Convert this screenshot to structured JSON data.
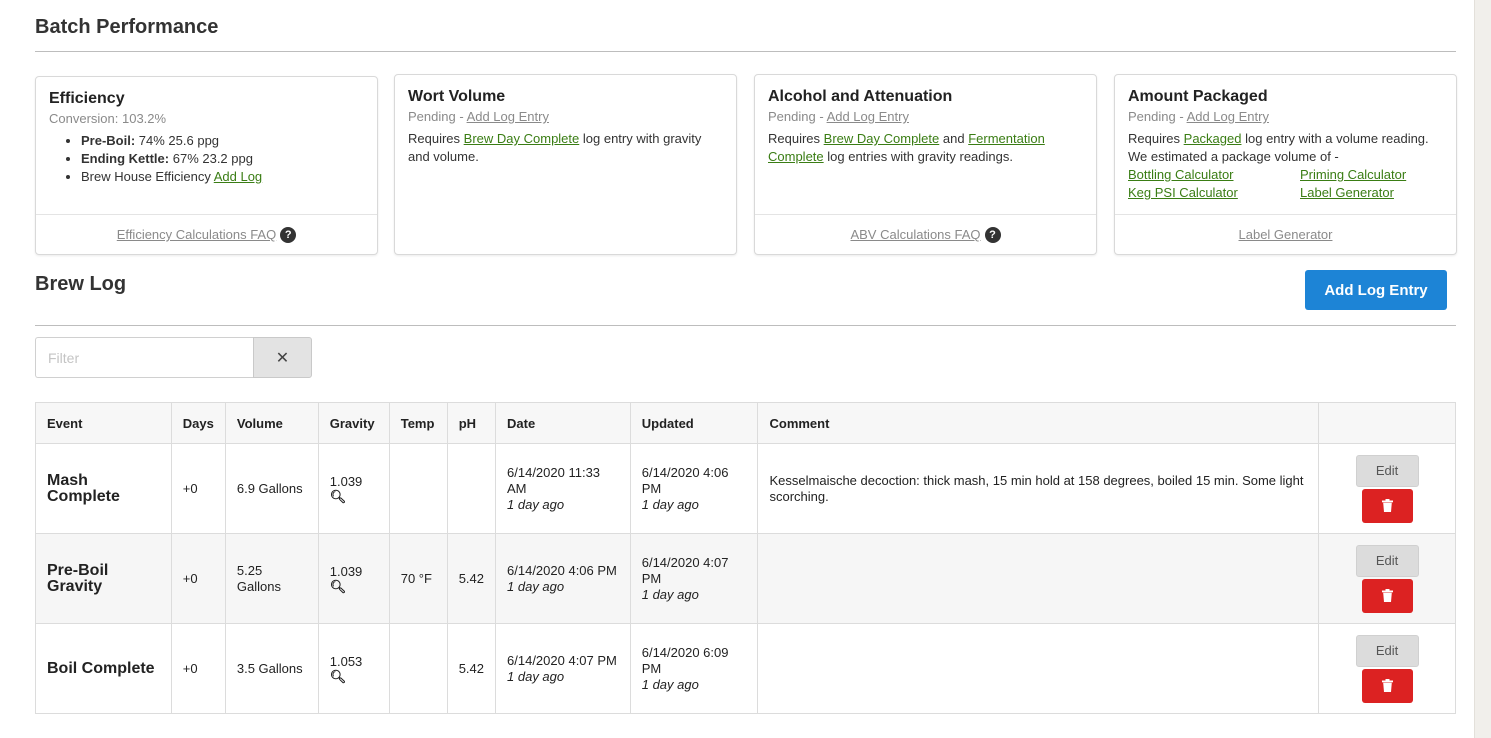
{
  "batch_performance": {
    "title": "Batch Performance",
    "efficiency": {
      "title": "Efficiency",
      "conversion": "Conversion: 103.2%",
      "items": [
        {
          "label": "Pre-Boil:",
          "value": "74% 25.6 ppg"
        },
        {
          "label": "Ending Kettle:",
          "value": "67% 23.2 ppg"
        }
      ],
      "brewhouse_label": "Brew House Efficiency",
      "brewhouse_link": "Add Log",
      "footer_link": "Efficiency Calculations FAQ"
    },
    "wort_volume": {
      "title": "Wort Volume",
      "pending": "Pending -",
      "pending_link": "Add Log Entry",
      "req_pre": "Requires",
      "req_link": "Brew Day Complete",
      "req_post": "log entry with gravity and volume."
    },
    "alcohol": {
      "title": "Alcohol and Attenuation",
      "pending": "Pending -",
      "pending_link": "Add Log Entry",
      "req_pre": "Requires",
      "req_link1": "Brew Day Complete",
      "req_and": "and",
      "req_link2": "Fermentation Complete",
      "req_post": "log entries with gravity readings.",
      "footer_link": "ABV Calculations FAQ"
    },
    "packaged": {
      "title": "Amount Packaged",
      "pending": "Pending -",
      "pending_link": "Add Log Entry",
      "req_pre": "Requires",
      "req_link": "Packaged",
      "req_post": "log entry with a volume reading. We estimated a package volume of -",
      "calculators": [
        "Bottling Calculator",
        "Priming Calculator",
        "Keg PSI Calculator",
        "Label Generator"
      ],
      "footer_link": "Label Generator"
    }
  },
  "brew_log": {
    "title": "Brew Log",
    "add_button": "Add Log Entry",
    "filter_placeholder": "Filter",
    "clear_symbol": "✕",
    "columns": [
      "Event",
      "Days",
      "Volume",
      "Gravity",
      "Temp",
      "pH",
      "Date",
      "Updated",
      "Comment",
      ""
    ],
    "rows": [
      {
        "event": "Mash Complete",
        "days": "+0",
        "volume": "6.9 Gallons",
        "gravity": "1.039",
        "temp": "",
        "ph": "",
        "date": "6/14/2020 11:33 AM",
        "date_ago": "1 day ago",
        "updated": "6/14/2020 4:06 PM",
        "updated_ago": "1 day ago",
        "comment": "Kesselmaische decoction: thick mash, 15 min hold at 158 degrees, boiled 15 min. Some light scorching."
      },
      {
        "event": "Pre-Boil Gravity",
        "days": "+0",
        "volume": "5.25 Gallons",
        "gravity": "1.039",
        "temp": "70 °F",
        "ph": "5.42",
        "date": "6/14/2020 4:06 PM",
        "date_ago": "1 day ago",
        "updated": "6/14/2020 4:07 PM",
        "updated_ago": "1 day ago",
        "comment": ""
      },
      {
        "event": "Boil Complete",
        "days": "+0",
        "volume": "3.5 Gallons",
        "gravity": "1.053",
        "temp": "",
        "ph": "5.42",
        "date": "6/14/2020 4:07 PM",
        "date_ago": "1 day ago",
        "updated": "6/14/2020 6:09 PM",
        "updated_ago": "1 day ago",
        "comment": ""
      }
    ],
    "edit_label": "Edit"
  },
  "colors": {
    "link_green": "#3a7d14",
    "primary_blue": "#1d84d6",
    "danger_red": "#dc2222"
  },
  "icons": {
    "faq": "question-circle-icon",
    "gravity": "search-icon",
    "delete": "trash-icon",
    "clear": "times-icon"
  }
}
